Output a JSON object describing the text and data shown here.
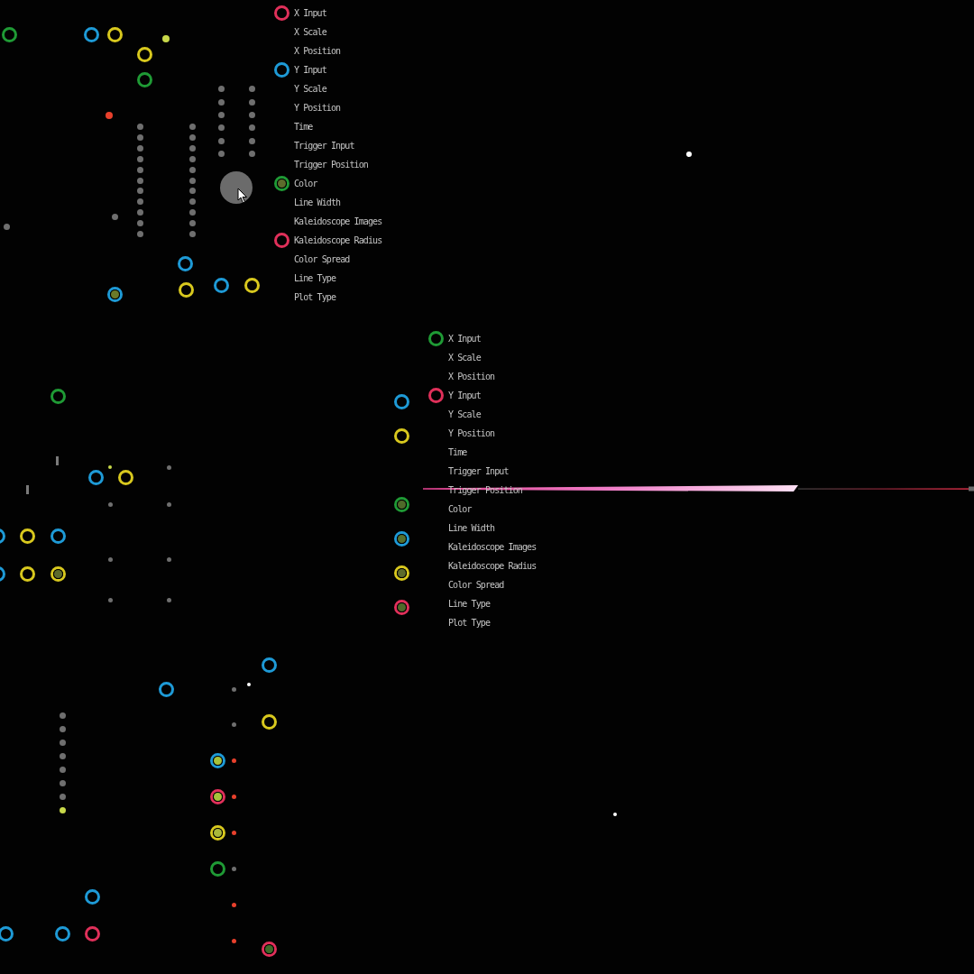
{
  "canvas": {
    "ports": [
      {
        "color": "#1f9a35",
        "connected": false
      },
      {
        "color": "#1e9ad6",
        "connected": false
      },
      {
        "color": "#d8c81e",
        "connected": false
      },
      {
        "color": "#d8c81e",
        "connected": false
      },
      {
        "color": "#1f9a35",
        "connected": false
      },
      {
        "color": "#1e9ad6",
        "connected": false
      },
      {
        "color": "#1e9ad6",
        "connected": true,
        "plug": {
          "color": "#6b7a2a"
        }
      },
      {
        "color": "#d8c81e",
        "connected": false
      },
      {
        "color": "#1e9ad6",
        "connected": false
      },
      {
        "color": "#d8c81e",
        "connected": false
      },
      {
        "color": "#1f9a35",
        "connected": false
      },
      {
        "color": "#1e9ad6",
        "connected": false
      },
      {
        "color": "#d8c81e",
        "connected": false
      },
      {
        "color": "#1e9ad6",
        "connected": false
      },
      {
        "color": "#d8c81e",
        "connected": false
      },
      {
        "color": "#1e9ad6",
        "connected": false
      },
      {
        "color": "#1e9ad6",
        "connected": false
      },
      {
        "color": "#d8c81e",
        "connected": false
      },
      {
        "color": "#d8c81e",
        "connected": true,
        "plug": {
          "color": "#5d6b2c"
        }
      },
      {
        "color": "#1e9ad6",
        "connected": false
      },
      {
        "color": "#d8c81e",
        "connected": false
      },
      {
        "color": "#1f9a35",
        "connected": true,
        "plug": {
          "color": "#4f6a2a"
        }
      },
      {
        "color": "#1e9ad6",
        "connected": true,
        "plug": {
          "color": "#56702e"
        }
      },
      {
        "color": "#d8c81e",
        "connected": true,
        "plug": {
          "color": "#5d6b2c"
        }
      },
      {
        "color": "#e0305a",
        "connected": true,
        "plug": {
          "color": "#4f6a2a"
        }
      },
      {
        "color": "#1e9ad6",
        "connected": false
      },
      {
        "color": "#1e9ad6",
        "connected": false
      },
      {
        "color": "#d8c81e",
        "connected": false
      },
      {
        "color": "#1e9ad6",
        "connected": true,
        "plug": {
          "color": "#a6c23a"
        }
      },
      {
        "color": "#e0305a",
        "connected": true,
        "plug": {
          "color": "#a6c23a"
        }
      },
      {
        "color": "#d8c81e",
        "connected": true,
        "plug": {
          "color": "#a9b83a"
        }
      },
      {
        "color": "#1f9a35",
        "connected": false
      },
      {
        "color": "#1e9ad6",
        "connected": false
      },
      {
        "color": "#1e9ad6",
        "connected": false
      },
      {
        "color": "#1e9ad6",
        "connected": false
      },
      {
        "color": "#e0305a",
        "connected": false
      },
      {
        "color": "#e0305a",
        "connected": true,
        "plug": {
          "color": "#3f6a2a"
        }
      }
    ],
    "dots": [
      {
        "kind": "dot",
        "color": "#6f6f6f"
      },
      {
        "kind": "dot",
        "color": "#6f6f6f"
      },
      {
        "kind": "dot",
        "color": "#6f6f6f"
      },
      {
        "kind": "dot",
        "color": "#6f6f6f"
      },
      {
        "kind": "dot",
        "color": "#6f6f6f"
      },
      {
        "kind": "dot",
        "color": "#6f6f6f"
      },
      {
        "kind": "dot",
        "color": "#6f6f6f"
      },
      {
        "kind": "dot",
        "color": "#6f6f6f"
      },
      {
        "kind": "dot",
        "color": "#6f6f6f"
      },
      {
        "kind": "dot",
        "color": "#6f6f6f"
      },
      {
        "kind": "dot",
        "color": "#6f6f6f"
      },
      {
        "kind": "dot",
        "color": "#6f6f6f"
      },
      {
        "kind": "dot",
        "color": "#6f6f6f"
      },
      {
        "kind": "dot",
        "color": "#6f6f6f"
      },
      {
        "kind": "dot",
        "color": "#6f6f6f"
      },
      {
        "kind": "dot",
        "color": "#6f6f6f"
      },
      {
        "kind": "dot",
        "color": "#6f6f6f"
      },
      {
        "kind": "dot",
        "color": "#6f6f6f"
      },
      {
        "kind": "dot",
        "color": "#6f6f6f"
      },
      {
        "kind": "dot",
        "color": "#6f6f6f"
      },
      {
        "kind": "dot",
        "color": "#6f6f6f"
      },
      {
        "kind": "dot",
        "color": "#6f6f6f"
      },
      {
        "kind": "dot",
        "color": "#6f6f6f"
      },
      {
        "kind": "dot",
        "color": "#6f6f6f"
      },
      {
        "kind": "dot",
        "color": "#6f6f6f"
      },
      {
        "kind": "dot",
        "color": "#6f6f6f"
      },
      {
        "kind": "dot",
        "color": "#6f6f6f"
      },
      {
        "kind": "dot",
        "color": "#6f6f6f"
      },
      {
        "kind": "dot",
        "color": "#6f6f6f"
      },
      {
        "kind": "dot",
        "color": "#6f6f6f"
      },
      {
        "kind": "dot",
        "color": "#6f6f6f"
      },
      {
        "kind": "dot",
        "color": "#6f6f6f"
      },
      {
        "kind": "dot",
        "color": "#6f6f6f"
      },
      {
        "kind": "dot",
        "color": "#6f6f6f"
      },
      {
        "kind": "dot",
        "color": "#6f6f6f"
      },
      {
        "kind": "dot",
        "color": "#6f6f6f"
      },
      {
        "kind": "dot",
        "color": "#e8402c"
      },
      {
        "kind": "dot",
        "color": "#c8d84a"
      },
      {
        "kind": "dot",
        "color": "#c8d84a"
      },
      {
        "kind": "dot",
        "color": "#6f6f6f"
      },
      {
        "kind": "dot",
        "color": "#6f6f6f"
      },
      {
        "kind": "dot",
        "color": "#6f6f6f"
      },
      {
        "kind": "dot",
        "color": "#6f6f6f"
      },
      {
        "kind": "dot",
        "color": "#6f6f6f"
      },
      {
        "kind": "dot",
        "color": "#6f6f6f"
      },
      {
        "kind": "dot",
        "color": "#6f6f6f"
      },
      {
        "kind": "bar",
        "color": "#7a7a7a"
      },
      {
        "kind": "bar",
        "color": "#7a7a7a"
      },
      {
        "kind": "dot",
        "color": "#6f6f6f"
      },
      {
        "kind": "dot",
        "color": "#6f6f6f"
      },
      {
        "kind": "dot",
        "color": "#6f6f6f"
      },
      {
        "kind": "dot",
        "color": "#6f6f6f"
      },
      {
        "kind": "dot",
        "color": "#6f6f6f"
      },
      {
        "kind": "dot",
        "color": "#6f6f6f"
      },
      {
        "kind": "dot",
        "color": "#6f6f6f"
      },
      {
        "kind": "dot",
        "color": "#c8d84a"
      },
      {
        "kind": "dot",
        "color": "#6f6f6f"
      },
      {
        "kind": "dot",
        "color": "#6f6f6f"
      },
      {
        "kind": "dot",
        "color": "#e8402c"
      },
      {
        "kind": "dot",
        "color": "#e8402c"
      },
      {
        "kind": "dot",
        "color": "#e8402c"
      },
      {
        "kind": "dot",
        "color": "#6f6f6f"
      },
      {
        "kind": "dot",
        "color": "#e8402c"
      },
      {
        "kind": "dot",
        "color": "#e8402c"
      },
      {
        "kind": "dot",
        "color": "#ffffff"
      },
      {
        "kind": "dot",
        "color": "#ffffff"
      },
      {
        "kind": "dot",
        "color": "#ffffff"
      }
    ]
  },
  "nodes": [
    {
      "parameters": [
        {
          "label": "X Input",
          "port": {
            "color": "#e0305a",
            "connected": false
          }
        },
        {
          "label": "X Scale"
        },
        {
          "label": "X Position"
        },
        {
          "label": "Y Input",
          "port": {
            "color": "#1e9ad6",
            "connected": false
          }
        },
        {
          "label": "Y Scale"
        },
        {
          "label": "Y Position"
        },
        {
          "label": "Time"
        },
        {
          "label": "Trigger Input"
        },
        {
          "label": "Trigger Position"
        },
        {
          "label": "Color",
          "port": {
            "color": "#1f9a35",
            "connected": true,
            "plug": {
              "color": "#5d6b2c"
            }
          }
        },
        {
          "label": "Line Width"
        },
        {
          "label": "Kaleidoscope Images"
        },
        {
          "label": "Kaleidoscope Radius",
          "port": {
            "color": "#e0305a",
            "connected": false
          }
        },
        {
          "label": "Color Spread"
        },
        {
          "label": "Line Type"
        },
        {
          "label": "Plot Type"
        }
      ]
    },
    {
      "parameters": [
        {
          "label": "X Input",
          "port": {
            "color": "#1f9a35",
            "connected": false
          }
        },
        {
          "label": "X Scale"
        },
        {
          "label": "X Position"
        },
        {
          "label": "Y Input",
          "port": {
            "color": "#e0305a",
            "connected": false
          }
        },
        {
          "label": "Y Scale"
        },
        {
          "label": "Y Position"
        },
        {
          "label": "Time"
        },
        {
          "label": "Trigger Input"
        },
        {
          "label": "Trigger Position"
        },
        {
          "label": "Color"
        },
        {
          "label": "Line Width"
        },
        {
          "label": "Kaleidoscope Images"
        },
        {
          "label": "Kaleidoscope Radius"
        },
        {
          "label": "Color Spread"
        },
        {
          "label": "Line Type"
        },
        {
          "label": "Plot Type"
        }
      ]
    }
  ]
}
